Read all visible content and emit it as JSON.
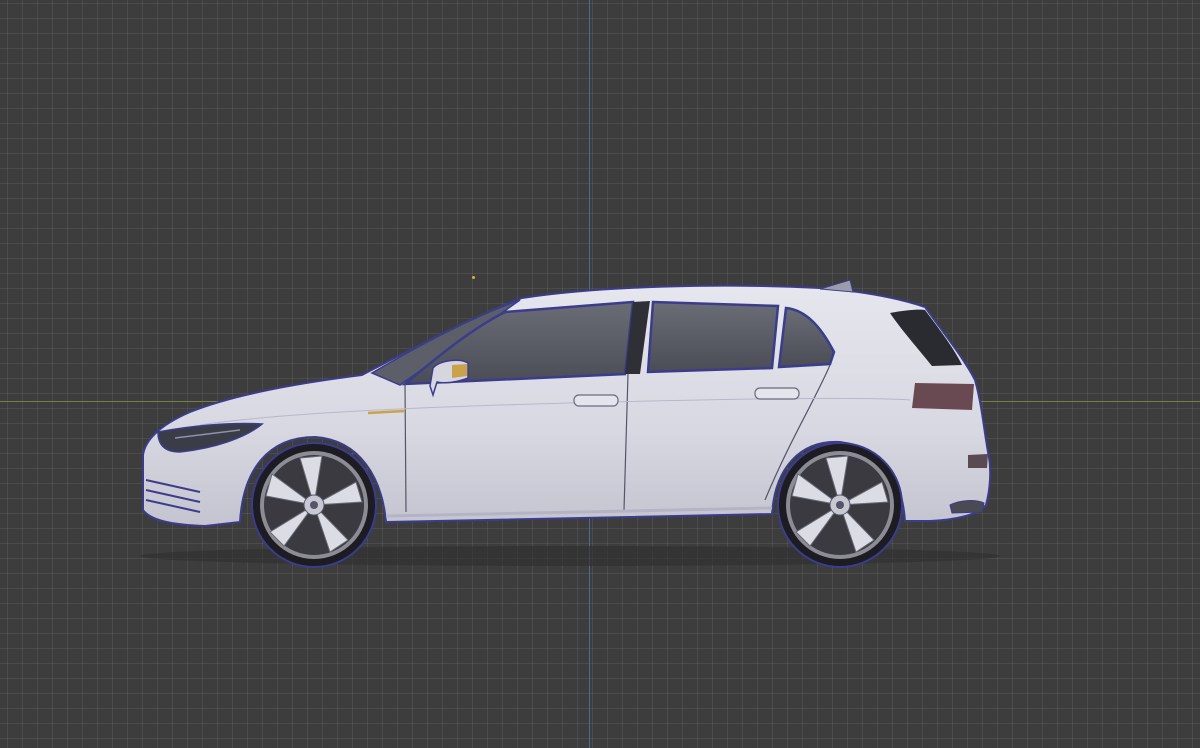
{
  "viewport": {
    "view": "right-orthographic",
    "background_color": "#3d3d3d",
    "grid_color": "#4a4a4a",
    "x_axis_color": "#7c8a3c",
    "z_axis_color": "#4c6fa6"
  },
  "model": {
    "object": "hatchback-car",
    "body_color": "#dcdce6",
    "outline_color": "#3c3c8c",
    "glass_color": "#5a5c64",
    "selected": true
  }
}
